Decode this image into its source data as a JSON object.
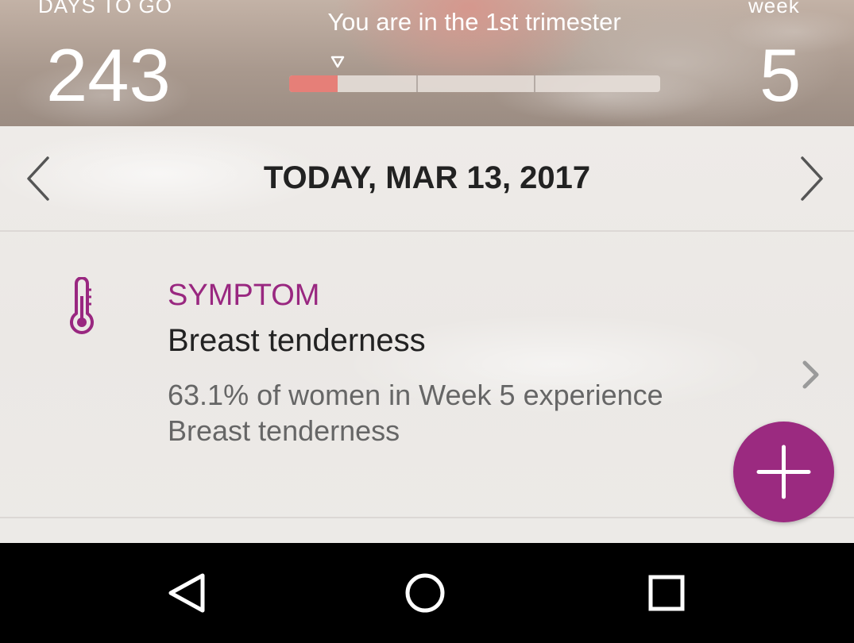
{
  "header": {
    "days_label": "DAYS TO GO",
    "days_value": "243",
    "trimester_text": "You are in the 1st trimester",
    "week_label": "week",
    "week_value": "5",
    "trimester_progress": 0.13
  },
  "date_nav": {
    "date_text": "TODAY, MAR 13, 2017",
    "prev_icon": "chevron-left-icon",
    "next_icon": "chevron-right-icon"
  },
  "symptom_card": {
    "category": "SYMPTOM",
    "name": "Breast tenderness",
    "description": "63.1% of women in Week 5 experience Breast tenderness",
    "icon": "thermometer-icon"
  },
  "fab": {
    "icon": "plus-icon"
  },
  "system_nav": {
    "back_icon": "back-triangle-icon",
    "home_icon": "home-circle-icon",
    "recents_icon": "recents-square-icon"
  },
  "colors": {
    "accent": "#992780",
    "progress_fill": "#e67f78"
  }
}
